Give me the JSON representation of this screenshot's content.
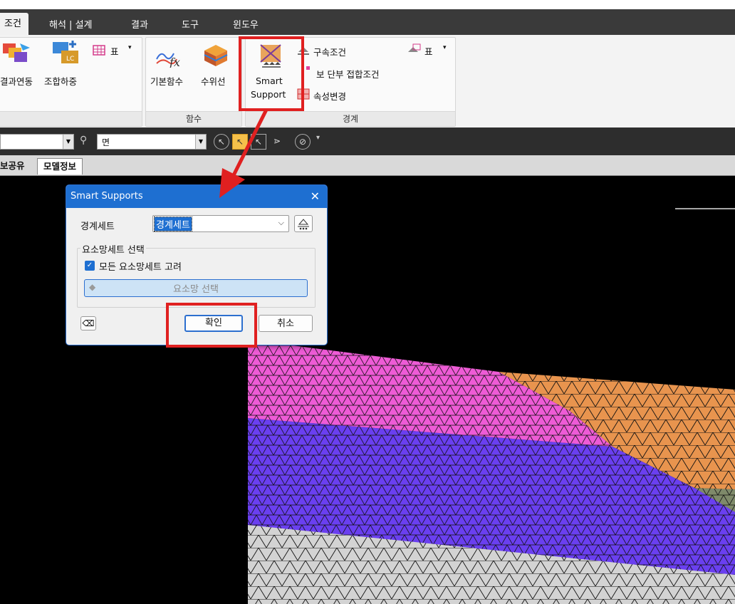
{
  "menu": {
    "tabs": [
      "조건",
      "해석 | 설계",
      "결과",
      "도구",
      "윈도우"
    ]
  },
  "ribbon": {
    "left_group": {
      "result_link_label": "결과연동",
      "combo_load_label": "조합하중",
      "table_label": "표"
    },
    "function_group": {
      "title": "함수",
      "basic_func_label": "기본함수",
      "water_level_label": "수위선"
    },
    "boundary_group": {
      "title": "경계",
      "smart_support_line1": "Smart",
      "smart_support_line2": "Support",
      "constraint_label": "구속조건",
      "beam_end_label": "보 단부 접합조건",
      "property_change_label": "속성변경",
      "table_label": "표"
    }
  },
  "toolbar": {
    "face_combo_value": "면"
  },
  "doc_tabs": [
    "보공유",
    "모델정보"
  ],
  "dialog": {
    "title": "Smart Supports",
    "boundary_set_label": "경계세트",
    "boundary_set_value": "경계세트",
    "mesh_group_label": "요소망세트 선택",
    "consider_all_label": "모든 요소망세트 고려",
    "consider_all_checked": true,
    "mesh_select_label": "요소망 선택",
    "ok_label": "확인",
    "cancel_label": "취소"
  },
  "colors": {
    "accent": "#1e6fd1",
    "highlight": "#e02020",
    "mesh_pink": "#ee5bd6",
    "mesh_orange": "#e8944e",
    "mesh_purple": "#6a3ff0",
    "mesh_gray": "#d3d3d3"
  }
}
